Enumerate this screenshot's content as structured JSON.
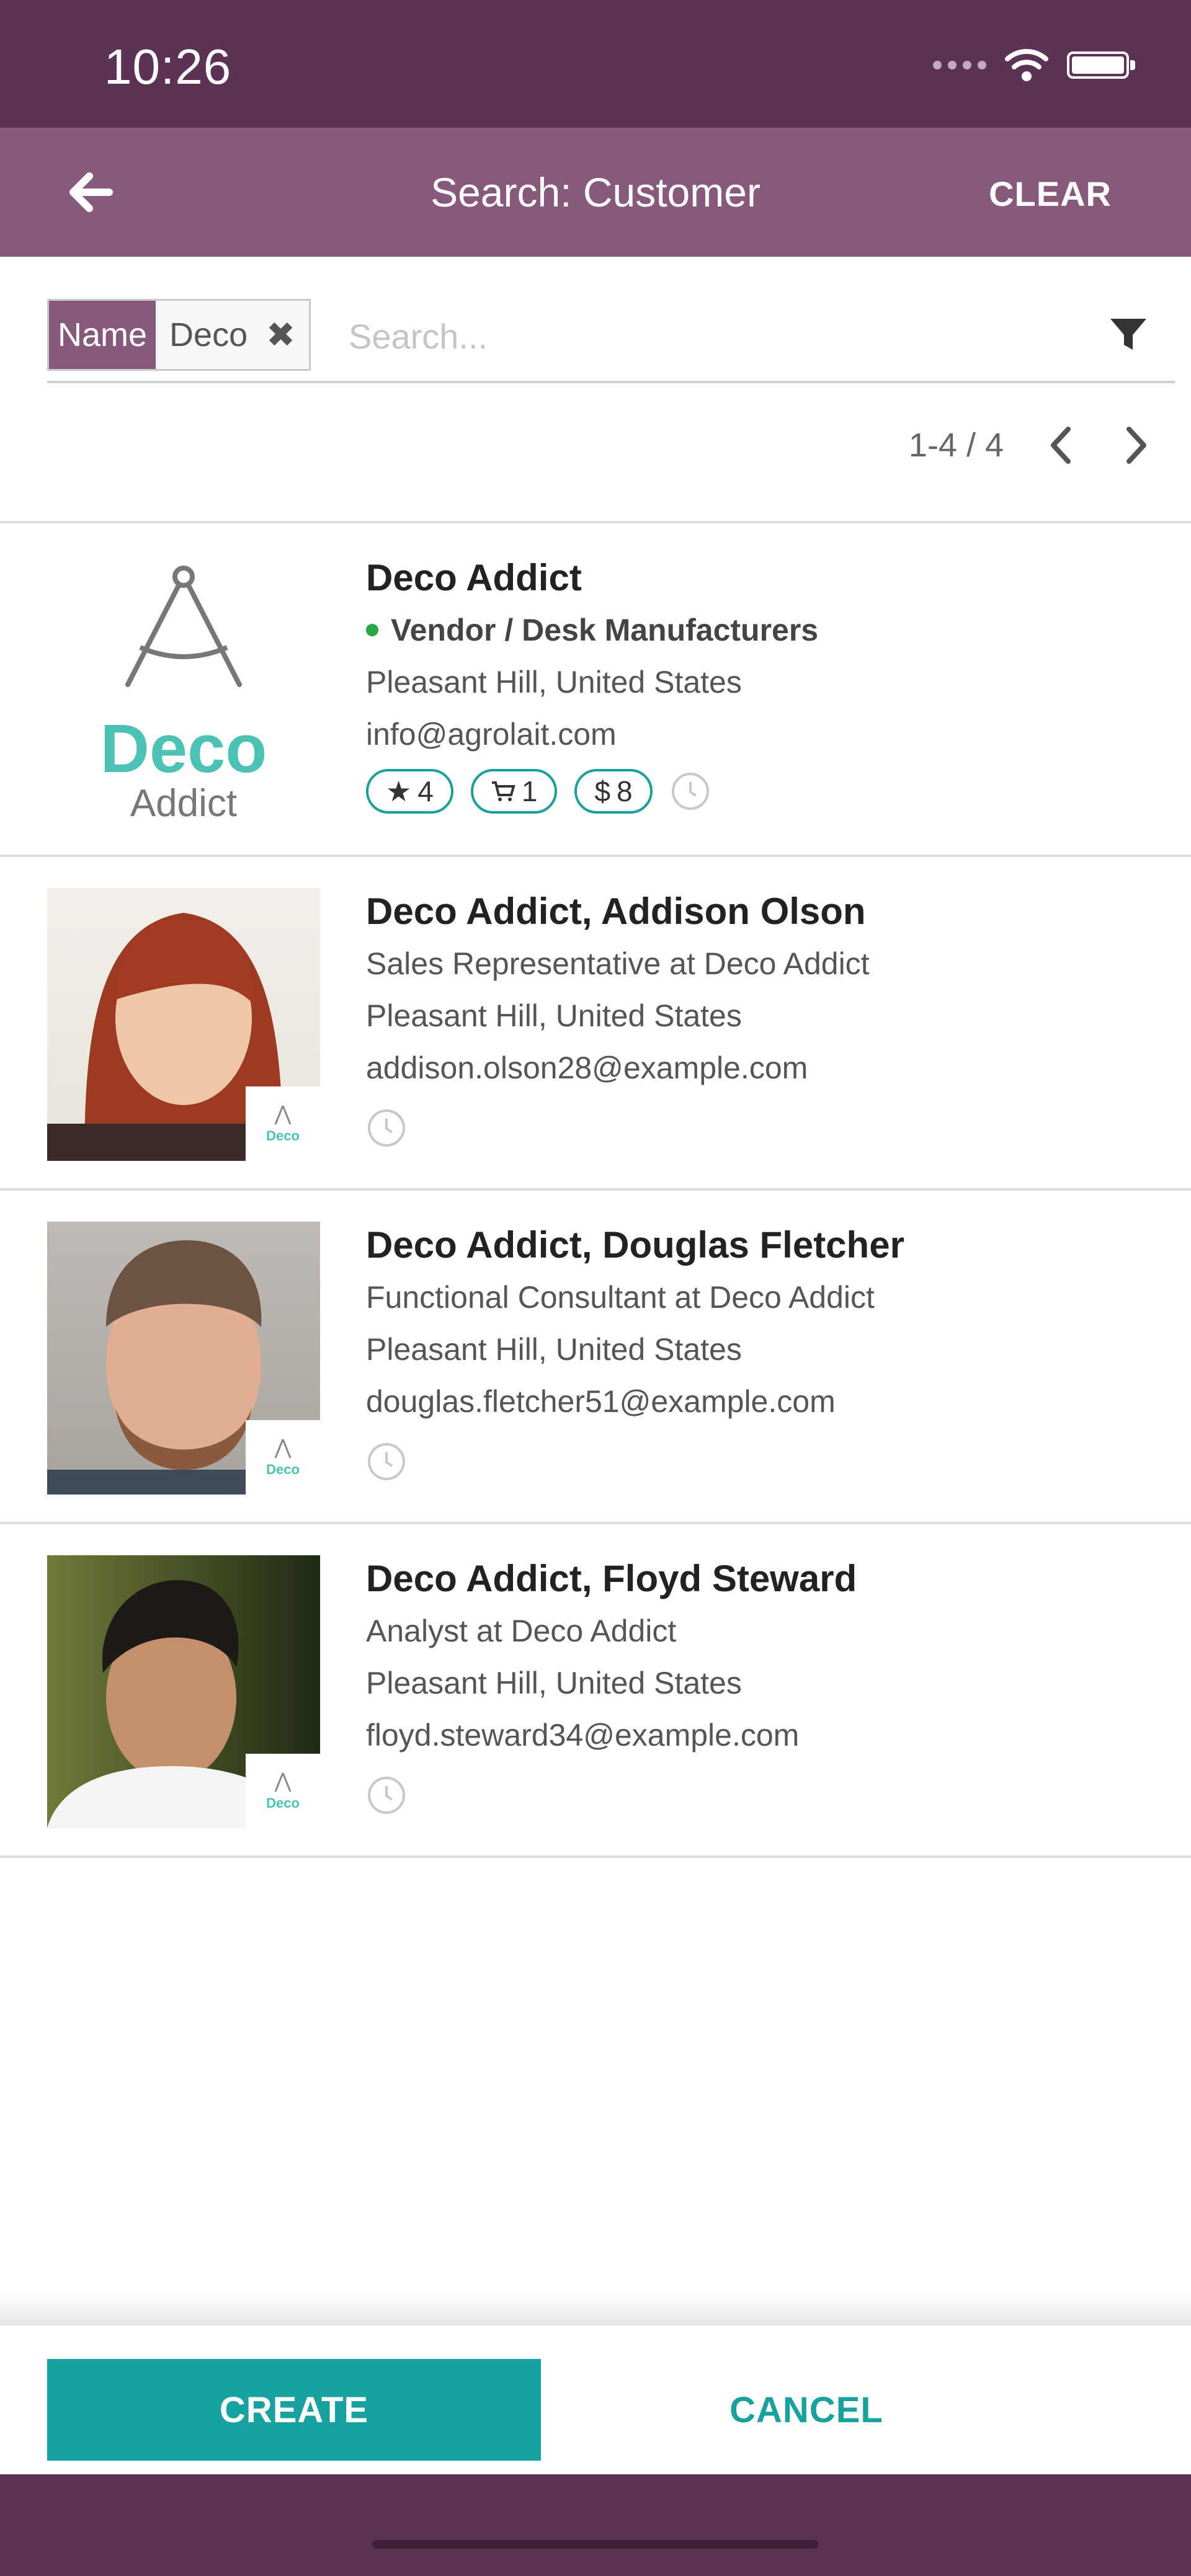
{
  "status_bar": {
    "time": "10:26"
  },
  "nav": {
    "title": "Search: Customer",
    "clear_label": "CLEAR"
  },
  "search": {
    "facet_name": "Name",
    "facet_value": "Deco",
    "placeholder": "Search...",
    "value": ""
  },
  "pager": {
    "value": "1-4 / 4"
  },
  "records": [
    {
      "name": "Deco Addict",
      "tag": "Vendor / Desk Manufacturers",
      "location": "Pleasant Hill, United States",
      "email": "info@agrolait.com",
      "badges": [
        "4",
        "1",
        "8"
      ],
      "logo_line1": "Deco",
      "logo_line2": "Addict"
    },
    {
      "name": "Deco Addict, Addison Olson",
      "job": "Sales Representative at Deco Addict",
      "location": "Pleasant Hill, United States",
      "email": "addison.olson28@example.com"
    },
    {
      "name": "Deco Addict, Douglas Fletcher",
      "job": "Functional Consultant at Deco Addict",
      "location": "Pleasant Hill, United States",
      "email": "douglas.fletcher51@example.com"
    },
    {
      "name": "Deco Addict, Floyd Steward",
      "job": "Analyst at Deco Addict",
      "location": "Pleasant Hill, United States",
      "email": "floyd.steward34@example.com"
    }
  ],
  "mini_logo_text": "Deco",
  "footer": {
    "create_label": "CREATE",
    "cancel_label": "CANCEL"
  },
  "colors": {
    "brand_dark": "#5c3255",
    "brand": "#875a7b",
    "accent": "#17a2a0"
  }
}
